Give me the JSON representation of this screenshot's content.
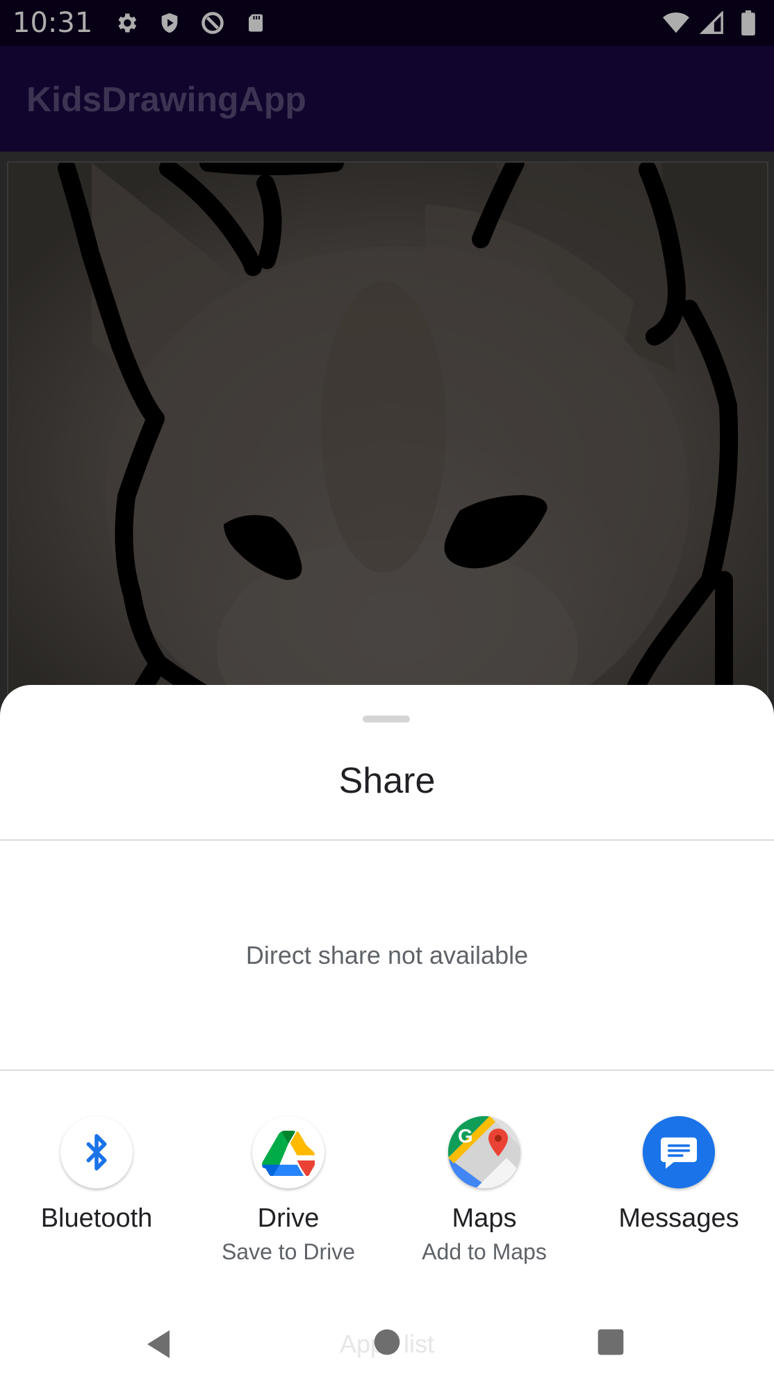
{
  "status_bar": {
    "time": "10:31",
    "left_icons": [
      "settings-icon",
      "shield-icon",
      "data-saver-icon",
      "sd-card-icon"
    ],
    "right_icons": [
      "wifi-icon",
      "cell-signal-icon",
      "battery-icon"
    ]
  },
  "app_bar": {
    "title": "KidsDrawingApp"
  },
  "sheet": {
    "title": "Share",
    "direct_share_message": "Direct share not available",
    "targets": [
      {
        "label": "Bluetooth",
        "sub": "",
        "icon": "bluetooth-icon"
      },
      {
        "label": "Drive",
        "sub": "Save to Drive",
        "icon": "google-drive-icon"
      },
      {
        "label": "Maps",
        "sub": "Add to Maps",
        "icon": "google-maps-icon"
      },
      {
        "label": "Messages",
        "sub": "",
        "icon": "messages-icon"
      }
    ]
  },
  "nav": {
    "watermark": "Apps list",
    "buttons": [
      "back-icon",
      "home-icon",
      "recents-icon"
    ]
  },
  "colors": {
    "status_bar": "#0d0120",
    "app_bar": "#1a0843",
    "bluetooth": "#1a73e8",
    "messages": "#1a73e8"
  }
}
